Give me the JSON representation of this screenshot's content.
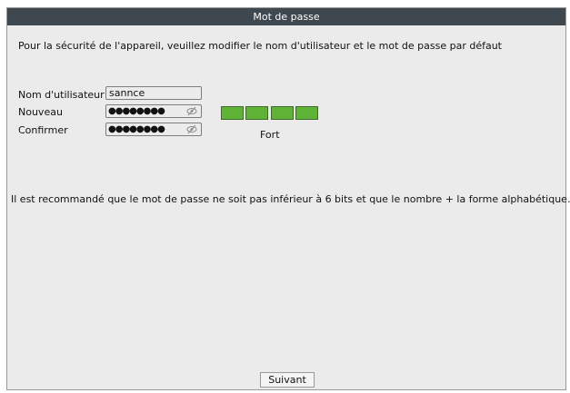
{
  "dialog": {
    "title": "Mot de passe",
    "intro": "Pour la sécurité de l'appareil, veuillez modifier le nom d'utilisateur et le mot de passe par défaut",
    "username_label": "Nom d'utilisateur",
    "username_value": "sannce",
    "new_label": "Nouveau",
    "new_value": "●●●●●●●●",
    "confirm_label": "Confirmer",
    "confirm_value": "●●●●●●●●",
    "strength_label": "Fort",
    "strength_segments": 4,
    "strength_color": "#5fb336",
    "recommendation": "Il est recommandé que le mot de passe ne soit pas inférieur à 6 bits et que le nombre + la forme alphabétique.",
    "next_button": "Suivant",
    "icons": {
      "password_toggle": "eye-off-icon"
    }
  }
}
